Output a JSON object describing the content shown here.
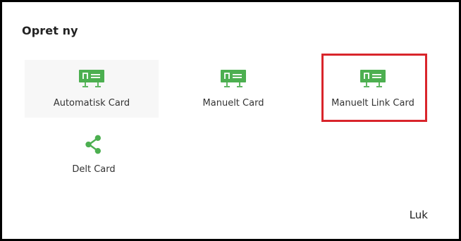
{
  "dialog": {
    "title": "Opret ny",
    "options": [
      {
        "label": "Automatisk Card",
        "icon": "id-card-icon",
        "selected": true
      },
      {
        "label": "Manuelt Card",
        "icon": "id-card-icon",
        "selected": false
      },
      {
        "label": "Manuelt Link Card",
        "icon": "id-card-icon",
        "highlighted": true
      },
      {
        "label": "Delt Card",
        "icon": "share-icon",
        "selected": false
      }
    ],
    "close_label": "Luk"
  },
  "colors": {
    "icon_green": "#4caf50",
    "highlight_red": "#d9252b",
    "selected_bg": "#f7f7f7"
  }
}
